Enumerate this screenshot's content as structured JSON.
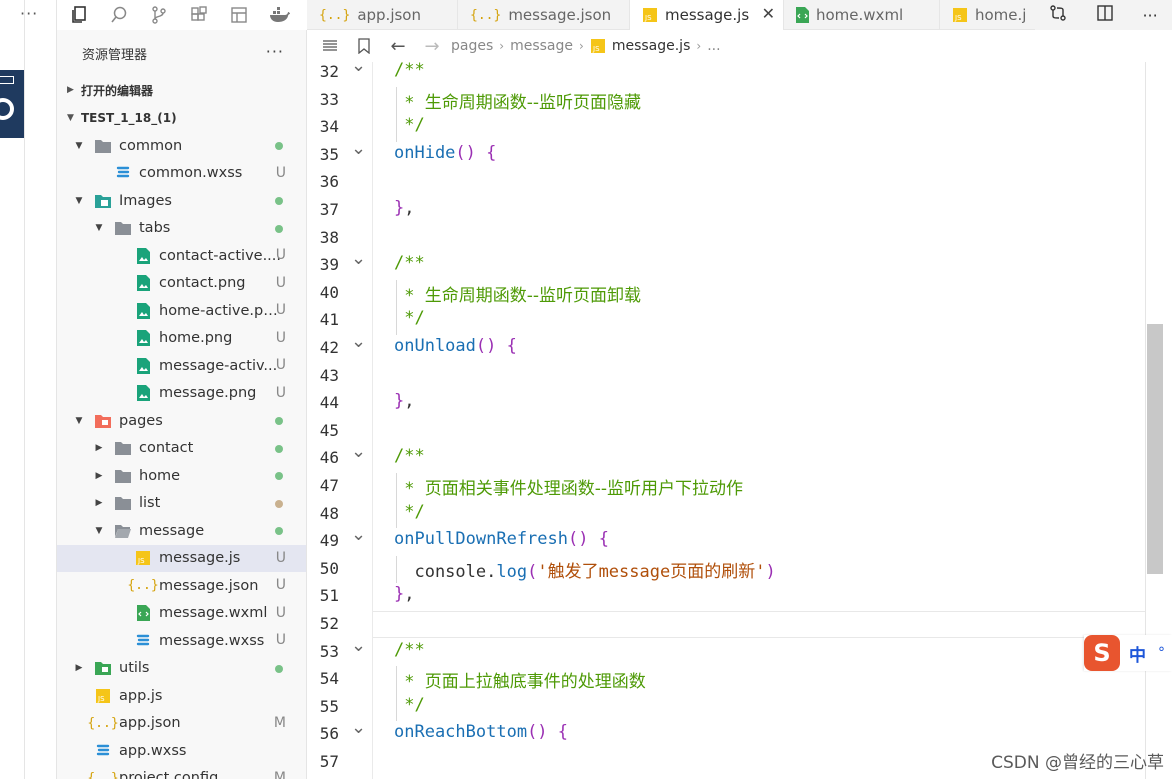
{
  "left_strip": {
    "more_label": "···"
  },
  "sidebar": {
    "title": "资源管理器",
    "more_label": "···",
    "open_editors_label": "打开的编辑器",
    "project_label": "TEST_1_18_(1)",
    "tree": [
      {
        "name": "common",
        "indent": 1,
        "arrow": "▼",
        "icon": "folder-icon",
        "dot": "green",
        "badge": ""
      },
      {
        "name": "common.wxss",
        "indent": 2,
        "arrow": "",
        "icon": "css-file-icon",
        "dot": "",
        "badge": "U"
      },
      {
        "name": "Images",
        "indent": 1,
        "arrow": "▼",
        "icon": "images-folder-icon",
        "dot": "green",
        "badge": ""
      },
      {
        "name": "tabs",
        "indent": 2,
        "arrow": "▼",
        "icon": "folder-icon",
        "dot": "green",
        "badge": ""
      },
      {
        "name": "contact-active....",
        "indent": 3,
        "arrow": "",
        "icon": "image-file-icon",
        "dot": "",
        "badge": "U"
      },
      {
        "name": "contact.png",
        "indent": 3,
        "arrow": "",
        "icon": "image-file-icon",
        "dot": "",
        "badge": "U"
      },
      {
        "name": "home-active.png",
        "indent": 3,
        "arrow": "",
        "icon": "image-file-icon",
        "dot": "",
        "badge": "U"
      },
      {
        "name": "home.png",
        "indent": 3,
        "arrow": "",
        "icon": "image-file-icon",
        "dot": "",
        "badge": "U"
      },
      {
        "name": "message-activ...",
        "indent": 3,
        "arrow": "",
        "icon": "image-file-icon",
        "dot": "",
        "badge": "U"
      },
      {
        "name": "message.png",
        "indent": 3,
        "arrow": "",
        "icon": "image-file-icon",
        "dot": "",
        "badge": "U"
      },
      {
        "name": "pages",
        "indent": 1,
        "arrow": "▼",
        "icon": "pages-folder-icon",
        "dot": "green",
        "badge": ""
      },
      {
        "name": "contact",
        "indent": 2,
        "arrow": "▶",
        "icon": "folder-icon",
        "dot": "green",
        "badge": ""
      },
      {
        "name": "home",
        "indent": 2,
        "arrow": "▶",
        "icon": "folder-icon",
        "dot": "green",
        "badge": ""
      },
      {
        "name": "list",
        "indent": 2,
        "arrow": "▶",
        "icon": "folder-icon",
        "dot": "brown",
        "badge": ""
      },
      {
        "name": "message",
        "indent": 2,
        "arrow": "▼",
        "icon": "folder-open-icon",
        "dot": "green",
        "badge": ""
      },
      {
        "name": "message.js",
        "indent": 3,
        "arrow": "",
        "icon": "js-file-icon",
        "dot": "",
        "badge": "U",
        "selected": true
      },
      {
        "name": "message.json",
        "indent": 3,
        "arrow": "",
        "icon": "json-file-icon",
        "dot": "",
        "badge": "U"
      },
      {
        "name": "message.wxml",
        "indent": 3,
        "arrow": "",
        "icon": "wxml-file-icon",
        "dot": "",
        "badge": "U"
      },
      {
        "name": "message.wxss",
        "indent": 3,
        "arrow": "",
        "icon": "css-file-icon",
        "dot": "",
        "badge": "U"
      },
      {
        "name": "utils",
        "indent": 1,
        "arrow": "▶",
        "icon": "utils-folder-icon",
        "dot": "green",
        "badge": ""
      },
      {
        "name": "app.js",
        "indent": 1,
        "arrow": "",
        "icon": "js-file-icon",
        "dot": "",
        "badge": ""
      },
      {
        "name": "app.json",
        "indent": 1,
        "arrow": "",
        "icon": "json-file-icon",
        "dot": "",
        "badge": "M"
      },
      {
        "name": "app.wxss",
        "indent": 1,
        "arrow": "",
        "icon": "css-file-icon",
        "dot": "",
        "badge": ""
      },
      {
        "name": "project.config.json",
        "indent": 1,
        "arrow": "",
        "icon": "json-file-icon",
        "dot": "",
        "badge": "M"
      }
    ]
  },
  "tabs": [
    {
      "label": "app.json",
      "icon": "json-file-icon",
      "active": false
    },
    {
      "label": "message.json",
      "icon": "json-file-icon",
      "active": false
    },
    {
      "label": "message.js",
      "icon": "js-file-icon",
      "active": true
    },
    {
      "label": "home.wxml",
      "icon": "wxml-file-icon",
      "active": false
    },
    {
      "label": "home.j",
      "icon": "js-file-icon",
      "active": false
    }
  ],
  "breadcrumb": {
    "items": [
      "pages",
      "message",
      "message.js",
      "..."
    ]
  },
  "editor": {
    "current_line": 52,
    "lines": [
      {
        "n": 32,
        "fold": true,
        "parts": [
          [
            "cm-mono",
            "/**"
          ]
        ]
      },
      {
        "n": 33,
        "fold": false,
        "parts": [
          [
            "cm-mono",
            " * "
          ],
          [
            "cm",
            "生命周期函数--监听页面隐藏"
          ]
        ]
      },
      {
        "n": 34,
        "fold": false,
        "parts": [
          [
            "cm-mono",
            " */"
          ]
        ]
      },
      {
        "n": 35,
        "fold": true,
        "parts": [
          [
            "fn",
            "onHide"
          ],
          [
            "pn",
            "()"
          ],
          [
            "plain",
            " "
          ],
          [
            "pn",
            "{"
          ]
        ]
      },
      {
        "n": 36,
        "fold": false,
        "parts": []
      },
      {
        "n": 37,
        "fold": false,
        "parts": [
          [
            "pn",
            "}"
          ],
          [
            "plain",
            ","
          ]
        ]
      },
      {
        "n": 38,
        "fold": false,
        "parts": []
      },
      {
        "n": 39,
        "fold": true,
        "parts": [
          [
            "cm-mono",
            "/**"
          ]
        ]
      },
      {
        "n": 40,
        "fold": false,
        "parts": [
          [
            "cm-mono",
            " * "
          ],
          [
            "cm",
            "生命周期函数--监听页面卸载"
          ]
        ]
      },
      {
        "n": 41,
        "fold": false,
        "parts": [
          [
            "cm-mono",
            " */"
          ]
        ]
      },
      {
        "n": 42,
        "fold": true,
        "parts": [
          [
            "fn",
            "onUnload"
          ],
          [
            "pn",
            "()"
          ],
          [
            "plain",
            " "
          ],
          [
            "pn",
            "{"
          ]
        ]
      },
      {
        "n": 43,
        "fold": false,
        "parts": []
      },
      {
        "n": 44,
        "fold": false,
        "parts": [
          [
            "pn",
            "}"
          ],
          [
            "plain",
            ","
          ]
        ]
      },
      {
        "n": 45,
        "fold": false,
        "parts": []
      },
      {
        "n": 46,
        "fold": true,
        "parts": [
          [
            "cm-mono",
            "/**"
          ]
        ]
      },
      {
        "n": 47,
        "fold": false,
        "parts": [
          [
            "cm-mono",
            " * "
          ],
          [
            "cm",
            "页面相关事件处理函数--监听用户下拉动作"
          ]
        ]
      },
      {
        "n": 48,
        "fold": false,
        "parts": [
          [
            "cm-mono",
            " */"
          ]
        ]
      },
      {
        "n": 49,
        "fold": true,
        "parts": [
          [
            "fn",
            "onPullDownRefresh"
          ],
          [
            "pn",
            "()"
          ],
          [
            "plain",
            " "
          ],
          [
            "pn",
            "{"
          ]
        ]
      },
      {
        "n": 50,
        "fold": false,
        "parts": [
          [
            "plain",
            "  console."
          ],
          [
            "fn",
            "log"
          ],
          [
            "pn",
            "("
          ],
          [
            "str",
            "'触发了message页面的刷新'"
          ],
          [
            "pn",
            ")"
          ]
        ]
      },
      {
        "n": 51,
        "fold": false,
        "parts": [
          [
            "pn",
            "}"
          ],
          [
            "plain",
            ","
          ]
        ]
      },
      {
        "n": 52,
        "fold": false,
        "parts": []
      },
      {
        "n": 53,
        "fold": true,
        "parts": [
          [
            "cm-mono",
            "/**"
          ]
        ]
      },
      {
        "n": 54,
        "fold": false,
        "parts": [
          [
            "cm-mono",
            " * "
          ],
          [
            "cm",
            "页面上拉触底事件的处理函数"
          ]
        ]
      },
      {
        "n": 55,
        "fold": false,
        "parts": [
          [
            "cm-mono",
            " */"
          ]
        ]
      },
      {
        "n": 56,
        "fold": true,
        "parts": [
          [
            "fn",
            "onReachBottom"
          ],
          [
            "pn",
            "()"
          ],
          [
            "plain",
            " "
          ],
          [
            "pn",
            "{"
          ]
        ]
      },
      {
        "n": 57,
        "fold": false,
        "parts": []
      }
    ]
  },
  "ime": {
    "logo": "S",
    "mode": "中",
    "dot": "°"
  },
  "watermark": "CSDN @曾经的三心草"
}
